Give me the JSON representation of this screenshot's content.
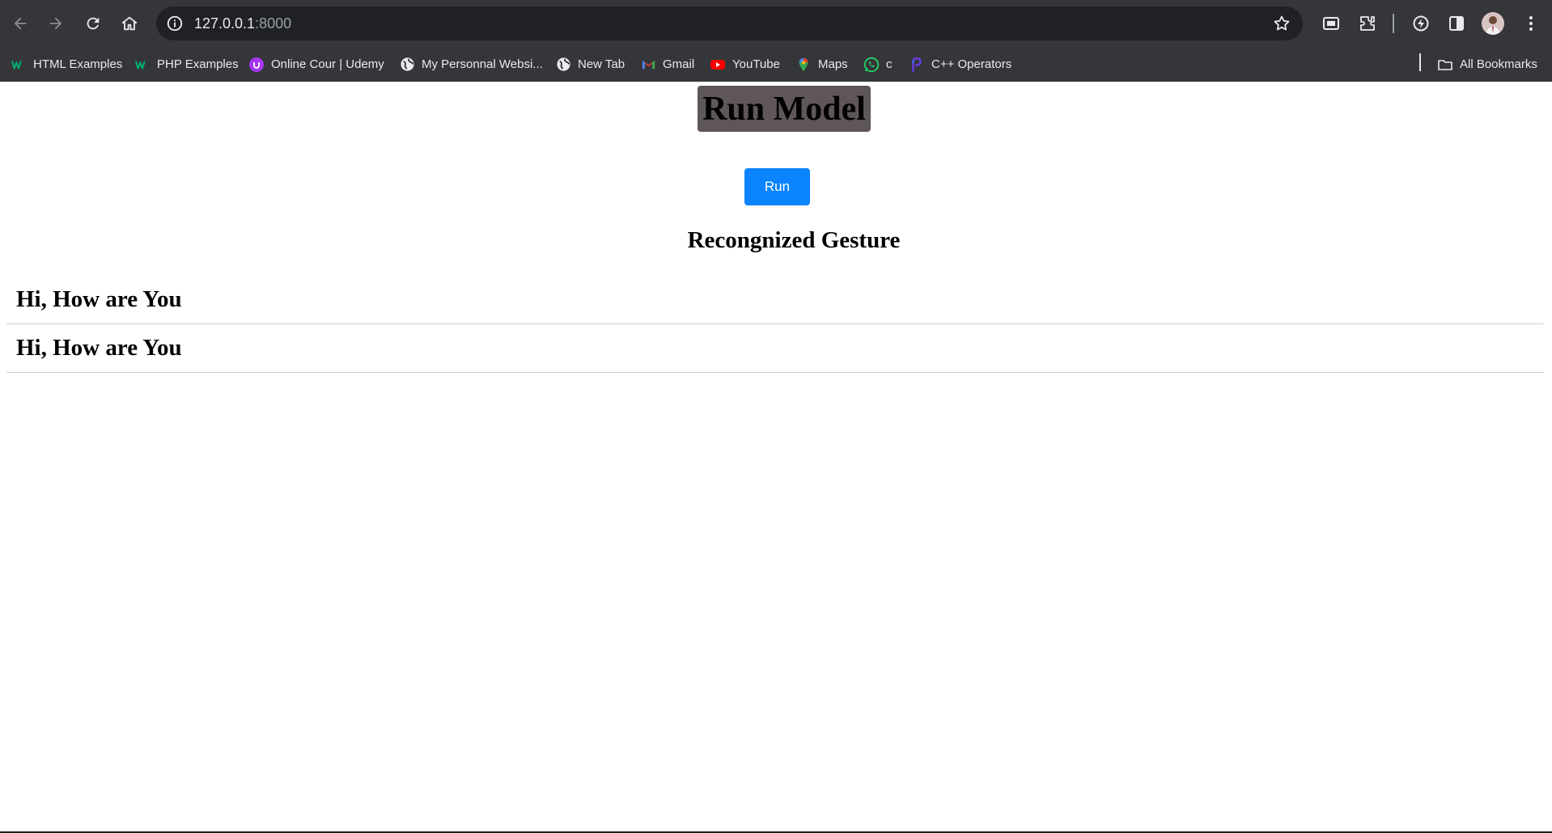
{
  "browser": {
    "url_host": "127.0.0.1",
    "url_port": ":8000",
    "bookmarks": [
      {
        "label": "HTML Examples",
        "icon": "w3schools-icon"
      },
      {
        "label": "PHP Examples",
        "icon": "w3schools-icon"
      },
      {
        "label": "Online Cour | Udemy",
        "icon": "udemy-icon"
      },
      {
        "label": "My Personnal Websi...",
        "icon": "globe-icon"
      },
      {
        "label": "New Tab",
        "icon": "globe-icon"
      },
      {
        "label": "Gmail",
        "icon": "gmail-icon"
      },
      {
        "label": "YouTube",
        "icon": "youtube-icon"
      },
      {
        "label": "Maps",
        "icon": "maps-icon"
      },
      {
        "label": "c",
        "icon": "whatsapp-icon"
      },
      {
        "label": "C++ Operators",
        "icon": "programiz-icon"
      }
    ],
    "all_bookmarks_label": "All Bookmarks"
  },
  "page": {
    "title": "Run Model",
    "run_button_label": "Run",
    "gesture_heading": "Recongnized Gesture",
    "results": [
      "Hi, How are You",
      "Hi, How are You"
    ]
  },
  "colors": {
    "title_bg": "#5f5757",
    "run_button_bg": "#0b84fe",
    "chrome_bg": "#35363a"
  }
}
